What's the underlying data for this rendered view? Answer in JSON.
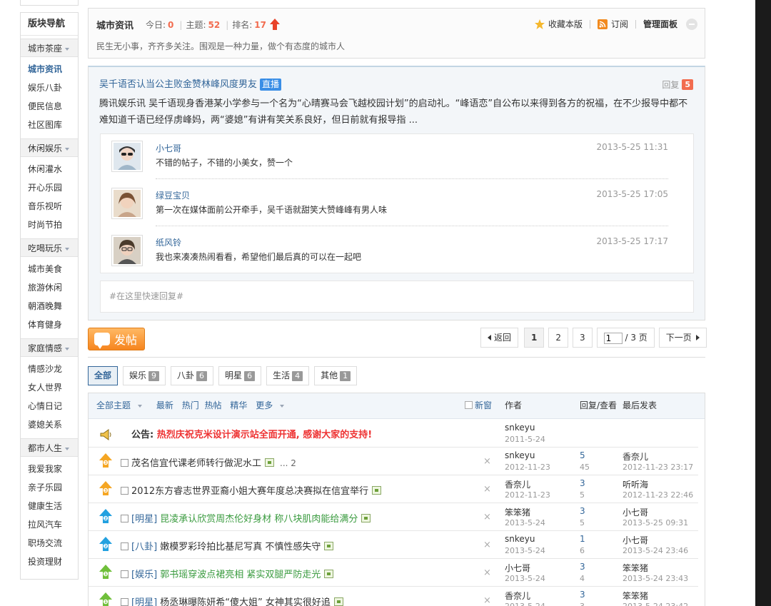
{
  "sidebar": {
    "title": "版块导航",
    "groups": [
      {
        "label": "城市茶座",
        "items": [
          "城市资讯",
          "娱乐八卦",
          "便民信息",
          "社区图库"
        ]
      },
      {
        "label": "休闲娱乐",
        "items": [
          "休闲灌水",
          "开心乐园",
          "音乐视听",
          "时尚节拍"
        ]
      },
      {
        "label": "吃喝玩乐",
        "items": [
          "城市美食",
          "旅游休闲",
          "朝酒晚舞",
          "体育健身"
        ]
      },
      {
        "label": "家庭情感",
        "items": [
          "情感沙龙",
          "女人世界",
          "心情日记",
          "婆媳关系"
        ]
      },
      {
        "label": "都市人生",
        "items": [
          "我爱我家",
          "亲子乐园",
          "健康生活",
          "拉风汽车",
          "职场交流",
          "投资理财"
        ]
      }
    ]
  },
  "header": {
    "title": "城市资讯",
    "today_label": "今日:",
    "today": "0",
    "topics_label": "主题:",
    "topics": "52",
    "rank_label": "排名:",
    "rank": "17",
    "desc": "民生无小事，齐齐多关注。围观是一种力量，做个有态度的城市人",
    "favorite": "收藏本版",
    "subscribe": "订阅",
    "manage": "管理面板"
  },
  "featured": {
    "title": "吴千语否认当公主败金赞林峰风度男友",
    "badge": "直播",
    "reply_label": "回复",
    "reply_count": "5",
    "body": "腾讯娱乐讯 吴千语现身香港某小学参与一个名为“心晴赛马会飞越校园计划”的启动礼。“峰语恋”自公布以来得到各方的祝福，在不少报导中都不难知道千语已经俘虏峰妈，两“婆媳”有讲有笑关系良好，但日前就有报导指 ...",
    "comments": [
      {
        "name": "小七哥",
        "time": "2013-5-25 11:31",
        "text": "不错的帖子，不错的小美女，赞一个"
      },
      {
        "name": "绿豆宝贝",
        "time": "2013-5-25 17:05",
        "text": "第一次在媒体面前公开牵手，吴千语就甜笑大赞峰峰有男人味"
      },
      {
        "name": "纸风铃",
        "time": "2013-5-25 17:17",
        "text": "我也来凑凑热闹看看，希望他们最后真的可以在一起吧"
      }
    ],
    "quick_reply": "#在这里快速回复#"
  },
  "post_button": "发帖",
  "pager": {
    "back": "返回",
    "pages": [
      "1",
      "2",
      "3"
    ],
    "current": "1",
    "total": "/ 3 页",
    "next": "下一页"
  },
  "category_tabs": [
    {
      "label": "全部",
      "count": ""
    },
    {
      "label": "娱乐",
      "count": "9"
    },
    {
      "label": "八卦",
      "count": "6"
    },
    {
      "label": "明星",
      "count": "6"
    },
    {
      "label": "生活",
      "count": "4"
    },
    {
      "label": "其他",
      "count": "1"
    }
  ],
  "thread_list": {
    "filters": {
      "all": "全部主题",
      "latest": "最新",
      "hot": "热门",
      "hotpost": "热帖",
      "digest": "精华",
      "more": "更多"
    },
    "new_window": "新窗",
    "col_author": "作者",
    "col_reply": "回复/查看",
    "col_last": "最后发表",
    "notice": {
      "label": "公告:",
      "text": "热烈庆祝克米设计演示站全面开通, 感谢大家的支持!",
      "author": "snkeyu",
      "date": "2011-5-24"
    },
    "rows": [
      {
        "tag": "",
        "title": "茂名信宜代课老师转行做泥水工",
        "pages": "... 2",
        "author": "snkeyu",
        "date": "2012-11-23",
        "replies": "5",
        "views": "45",
        "last_user": "香奈儿",
        "last_time": "2012-11-23 23:17"
      },
      {
        "tag": "",
        "title": "2012东方睿志世界亚裔小姐大赛年度总决赛拟在信宜举行",
        "pages": "",
        "author": "香奈儿",
        "date": "2012-11-23",
        "replies": "3",
        "views": "5",
        "last_user": "听听海",
        "last_time": "2012-11-23 22:46"
      },
      {
        "tag": "[明星]",
        "title": "昆凌承认欣赏周杰伦好身材 称八块肌肉能给满分",
        "pages": "",
        "author": "笨笨猪",
        "date": "2013-5-24",
        "replies": "3",
        "views": "5",
        "last_user": "小七哥",
        "last_time": "2013-5-25 09:31"
      },
      {
        "tag": "[八卦]",
        "title": "嫩模罗彩玲拍比基尼写真 不慎性感失守",
        "pages": "",
        "author": "snkeyu",
        "date": "2013-5-24",
        "replies": "1",
        "views": "6",
        "last_user": "小七哥",
        "last_time": "2013-5-24 23:46"
      },
      {
        "tag": "[娱乐]",
        "title": "郭书瑶穿波点裙亮相 紧实双腿严防走光",
        "pages": "",
        "author": "小七哥",
        "date": "2013-5-24",
        "replies": "3",
        "views": "4",
        "last_user": "笨笨猪",
        "last_time": "2013-5-24 23:43"
      },
      {
        "tag": "[明星]",
        "title": "杨丞琳曝陈妍希“傻大姐” 女神其实很好追",
        "pages": "",
        "author": "香奈儿",
        "date": "2013-5-24",
        "replies": "3",
        "views": "3",
        "last_user": "笨笨猪",
        "last_time": "2013-5-24 23:42"
      }
    ]
  },
  "colors": {
    "accent": "#336699",
    "orange": "#f6851f",
    "red_num": "#f26c4f",
    "notice": "#ee3333"
  }
}
